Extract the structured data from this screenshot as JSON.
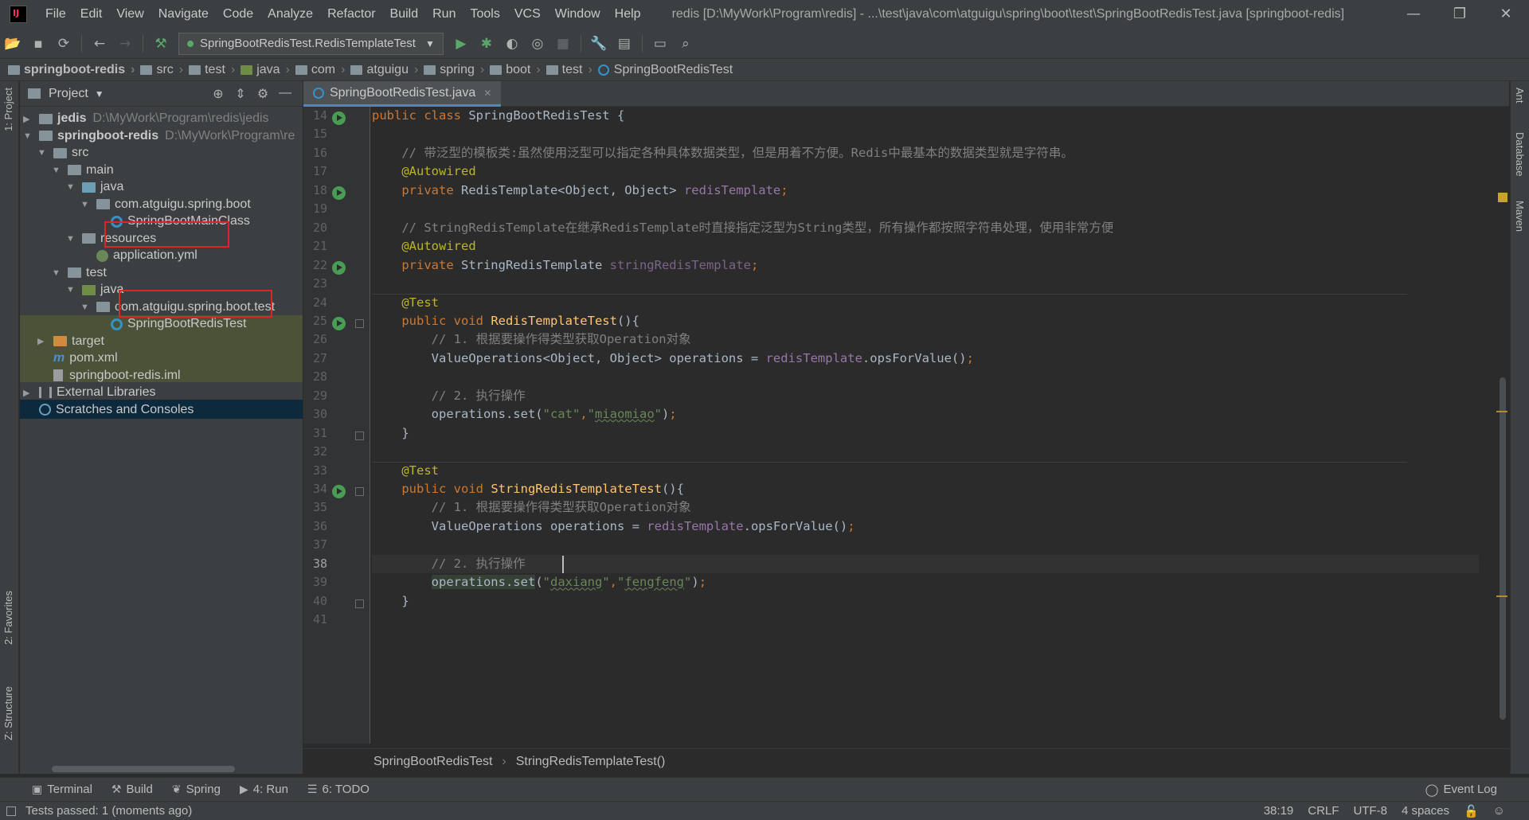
{
  "window": {
    "menu": [
      "File",
      "Edit",
      "View",
      "Navigate",
      "Code",
      "Analyze",
      "Refactor",
      "Build",
      "Run",
      "Tools",
      "VCS",
      "Window",
      "Help"
    ],
    "title": "redis [D:\\MyWork\\Program\\redis] - ...\\test\\java\\com\\atguigu\\spring\\boot\\test\\SpringBootRedisTest.java [springboot-redis]",
    "controls": [
      "—",
      "❐",
      "✕"
    ]
  },
  "toolbar": {
    "run_config": "SpringBootRedisTest.RedisTemplateTest",
    "icons": [
      "open-icon",
      "save-icon",
      "sync-icon",
      "back-icon",
      "forward-icon",
      "build-icon",
      "run-icon",
      "debug-icon",
      "coverage-icon",
      "profile-icon",
      "stop-icon",
      "settings-icon",
      "structure-icon",
      "terminal-icon",
      "search-icon"
    ]
  },
  "breadcrumb": [
    "springboot-redis",
    "src",
    "test",
    "java",
    "com",
    "atguigu",
    "spring",
    "boot",
    "test",
    "SpringBootRedisTest"
  ],
  "project": {
    "header": "Project",
    "tree": [
      {
        "label": "jedis",
        "hint": "D:\\MyWork\\Program\\redis\\jedis",
        "bold": true,
        "level": 0,
        "arrow": "▶",
        "icon": "folder"
      },
      {
        "label": "springboot-redis",
        "hint": "D:\\MyWork\\Program\\re",
        "bold": true,
        "level": 0,
        "arrow": "▼",
        "icon": "folder"
      },
      {
        "label": "src",
        "level": 1,
        "arrow": "▼",
        "icon": "folder"
      },
      {
        "label": "main",
        "level": 2,
        "arrow": "▼",
        "icon": "folder"
      },
      {
        "label": "java",
        "level": 3,
        "arrow": "▼",
        "icon": "src"
      },
      {
        "label": "com.atguigu.spring.boot",
        "level": 4,
        "arrow": "▼",
        "icon": "folder"
      },
      {
        "label": "SpringBootMainClass",
        "level": 5,
        "arrow": "",
        "icon": "class"
      },
      {
        "label": "resources",
        "level": 3,
        "arrow": "▼",
        "icon": "res"
      },
      {
        "label": "application.yml",
        "level": 4,
        "arrow": "",
        "icon": "yml"
      },
      {
        "label": "test",
        "level": 2,
        "arrow": "▼",
        "icon": "folder"
      },
      {
        "label": "java",
        "level": 3,
        "arrow": "▼",
        "icon": "test"
      },
      {
        "label": "com.atguigu.spring.boot.test",
        "level": 4,
        "arrow": "▼",
        "icon": "folder"
      },
      {
        "label": "SpringBootRedisTest",
        "level": 5,
        "arrow": "",
        "icon": "class"
      },
      {
        "label": "target",
        "level": 1,
        "arrow": "▶",
        "icon": "target"
      },
      {
        "label": "pom.xml",
        "level": 1,
        "arrow": "",
        "icon": "maven"
      },
      {
        "label": "springboot-redis.iml",
        "level": 1,
        "arrow": "",
        "icon": "file"
      },
      {
        "label": "External Libraries",
        "level": 0,
        "arrow": "▶",
        "icon": "lib"
      },
      {
        "label": "Scratches and Consoles",
        "level": 0,
        "arrow": "",
        "icon": "scratch"
      }
    ]
  },
  "left_strip": {
    "project": "1: Project",
    "favorites": "2: Favorites",
    "structure": "Z: Structure"
  },
  "right_strip": {
    "ant": "Ant",
    "database": "Database",
    "maven": "Maven"
  },
  "editor": {
    "tab": "SpringBootRedisTest.java",
    "cursor_line": "38",
    "lines": [
      {
        "n": "14",
        "html": "<span class=\"kw\">public class </span>SpringBootRedisTest {"
      },
      {
        "n": "15",
        "html": ""
      },
      {
        "n": "16",
        "html": "    <span class=\"cm\">// 带泛型的模板类:虽然使用泛型可以指定各种具体数据类型，但是用着不方便。Redis中最基本的数据类型就是字符串。</span>"
      },
      {
        "n": "17",
        "html": "    <span class=\"an\">@Autowired</span>"
      },
      {
        "n": "18",
        "html": "    <span class=\"kw\">private </span>RedisTemplate&lt;Object, Object&gt; <span class=\"fd\">redisTemplate</span><span class=\"kw\">;</span>"
      },
      {
        "n": "19",
        "html": ""
      },
      {
        "n": "20",
        "html": "    <span class=\"cm\">// StringRedisTemplate在继承RedisTemplate时直接指定泛型为String类型，所有操作都按照字符串处理，使用非常方便</span>"
      },
      {
        "n": "21",
        "html": "    <span class=\"an\">@Autowired</span>"
      },
      {
        "n": "22",
        "html": "    <span class=\"kw\">private </span>StringRedisTemplate <span class=\"fdg\">stringRedisTemplate</span><span class=\"kw\">;</span>"
      },
      {
        "n": "23",
        "html": ""
      },
      {
        "n": "24",
        "html": "    <span class=\"an\">@Test</span>"
      },
      {
        "n": "25",
        "html": "    <span class=\"kw\">public void </span><span class=\"mt\">RedisTemplateTest</span>(){"
      },
      {
        "n": "26",
        "html": "        <span class=\"cm\">// 1. 根据要操作得类型获取Operation对象</span>"
      },
      {
        "n": "27",
        "html": "        ValueOperations&lt;Object, Object&gt; operations = <span class=\"fd\">redisTemplate</span>.opsForValue()<span class=\"kw\">;</span>"
      },
      {
        "n": "28",
        "html": ""
      },
      {
        "n": "29",
        "html": "        <span class=\"cm\">// 2. 执行操作</span>"
      },
      {
        "n": "30",
        "html": "        operations.set(<span class=\"st\">\"cat\"</span><span class=\"kw\">,</span><span class=\"st\">\"</span><span class=\"stu\">miaomiao</span><span class=\"st\">\"</span>)<span class=\"kw\">;</span>"
      },
      {
        "n": "31",
        "html": "    }"
      },
      {
        "n": "32",
        "html": ""
      },
      {
        "n": "33",
        "html": "    <span class=\"an\">@Test</span>"
      },
      {
        "n": "34",
        "html": "    <span class=\"kw\">public void </span><span class=\"mt\">StringRedisTemplateTest</span>(){"
      },
      {
        "n": "35",
        "html": "        <span class=\"cm\">// 1. 根据要操作得类型获取Operation对象</span>"
      },
      {
        "n": "36",
        "html": "        ValueOperations operations = <span class=\"fd\">redisTemplate</span>.opsForValue()<span class=\"kw\">;</span>"
      },
      {
        "n": "37",
        "html": ""
      },
      {
        "n": "38",
        "html": "        <span class=\"cm\">// 2. 执行操作</span>"
      },
      {
        "n": "39",
        "html": "        <span class=\"hlw\">operations.set</span>(<span class=\"st\">\"</span><span class=\"stu\">daxiang</span><span class=\"st\">\"</span><span class=\"kw\">,</span><span class=\"st\">\"</span><span class=\"stu\">fengfeng</span><span class=\"st\">\"</span>)<span class=\"kw\">;</span>"
      },
      {
        "n": "40",
        "html": "    }"
      },
      {
        "n": "41",
        "html": ""
      }
    ],
    "breadcrumb": [
      "SpringBootRedisTest",
      "StringRedisTemplateTest()"
    ]
  },
  "bottom_tools": [
    {
      "label": "Terminal",
      "icon": "terminal-icon",
      "glyph": "▣"
    },
    {
      "label": "Build",
      "icon": "hammer-icon",
      "glyph": "⚒"
    },
    {
      "label": "Spring",
      "icon": "spring-icon",
      "glyph": "❦"
    },
    {
      "label": "4: Run",
      "icon": "run-icon",
      "glyph": "▶"
    },
    {
      "label": "6: TODO",
      "icon": "todo-icon",
      "glyph": "☰"
    }
  ],
  "event_log": "Event Log",
  "status": {
    "message": "Tests passed: 1 (moments ago)",
    "position": "38:19",
    "line_sep": "CRLF",
    "encoding": "UTF-8",
    "indent": "4 spaces"
  },
  "colors": {
    "accent": "#4a88c7",
    "highlight_box": "#e02424",
    "run_green": "#499c54"
  }
}
